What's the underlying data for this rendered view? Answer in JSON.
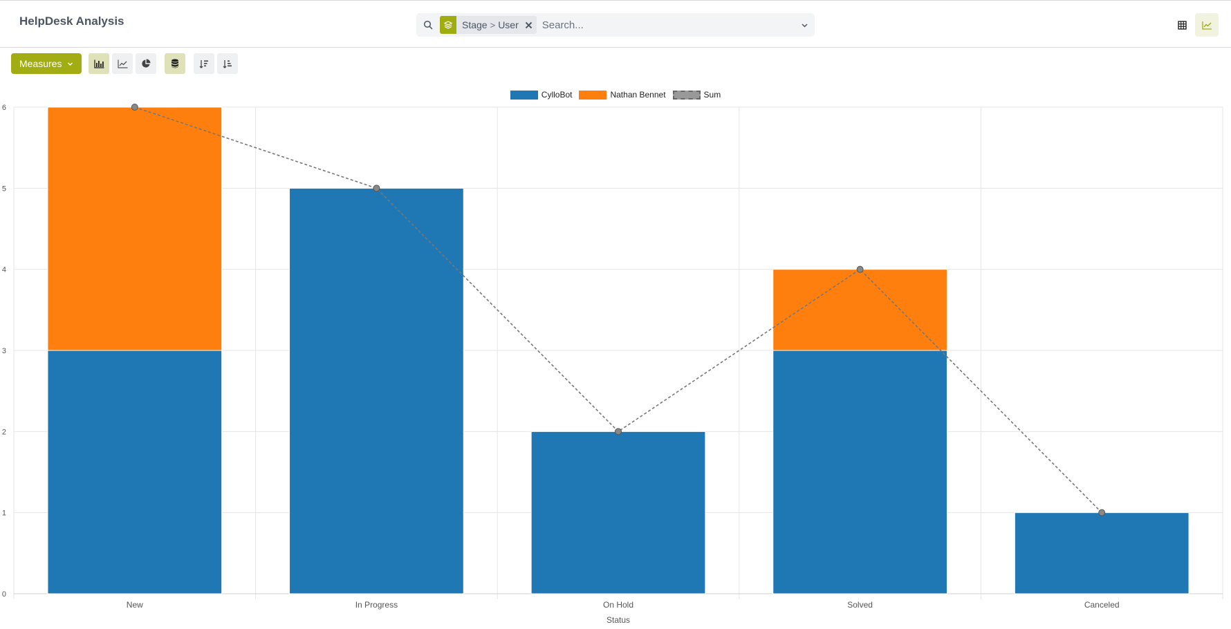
{
  "header": {
    "title": "HelpDesk Analysis"
  },
  "search": {
    "facet_parts": [
      "Stage",
      ">",
      "User"
    ],
    "placeholder": "Search..."
  },
  "toolbar": {
    "measures_label": "Measures"
  },
  "icons": {
    "search": "search-icon",
    "facet": "layers-icon",
    "remove": "close-icon",
    "toggle": "chevron-down-icon",
    "grid": "grid-icon",
    "graph": "line-chart-icon"
  },
  "colors": {
    "accent": "#a1ad12",
    "series1": "#1f77b4",
    "series2": "#ff7f0e",
    "sum": "#777777"
  },
  "chart_data": {
    "type": "bar",
    "stacked": true,
    "categories": [
      "New",
      "In Progress",
      "On Hold",
      "Solved",
      "Canceled"
    ],
    "series": [
      {
        "name": "CylloBot",
        "values": [
          3,
          5,
          2,
          3,
          1
        ],
        "color": "#1f77b4"
      },
      {
        "name": "Nathan Bennet",
        "values": [
          3,
          0,
          0,
          1,
          0
        ],
        "color": "#ff7f0e"
      }
    ],
    "line_series": {
      "name": "Sum",
      "values": [
        6,
        5,
        2,
        4,
        1
      ],
      "color": "#777777",
      "dashed": true
    },
    "xlabel": "Status",
    "ylabel": "",
    "ylim": [
      0,
      6
    ],
    "yticks": [
      0,
      1,
      2,
      3,
      4,
      5,
      6
    ],
    "grid": true,
    "legend_position": "top-center"
  }
}
